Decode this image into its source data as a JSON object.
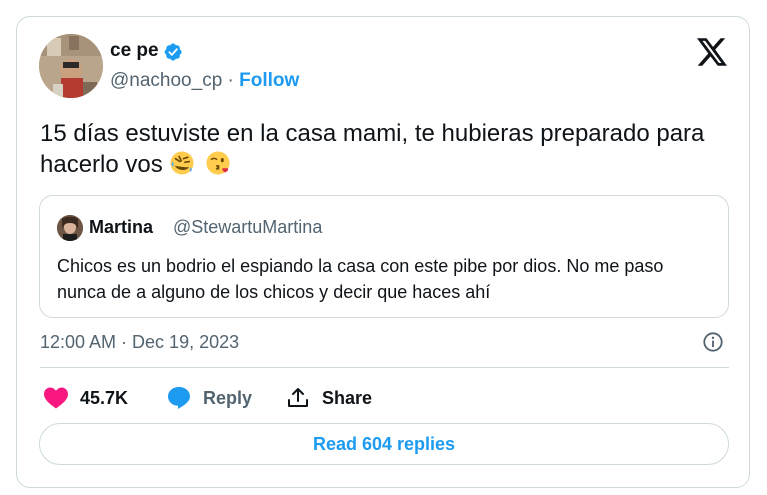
{
  "author": {
    "name": "ce pe",
    "handle": "@nachoo_cp",
    "separator": "·",
    "follow_label": "Follow"
  },
  "tweet": {
    "text": "15 días estuviste en la casa mami, te hubieras preparado para hacerlo vos",
    "emojis": [
      "rolling-on-floor-laughing-emoji",
      "face-blowing-kiss-emoji"
    ]
  },
  "quoted": {
    "name": "Martina",
    "handle": "@StewartuMartina",
    "text": "Chicos es un bodrio el espiando la casa con este pibe por dios. No me paso nunca de a alguno de los chicos y decir que haces ahí"
  },
  "meta": {
    "timestamp": "12:00 AM · Dec 19, 2023"
  },
  "actions": {
    "likes": "45.7K",
    "reply_label": "Reply",
    "share_label": "Share"
  },
  "read_replies_label": "Read 604 replies",
  "colors": {
    "accent": "#1d9bf0",
    "like": "#f91880",
    "muted": "#536471",
    "border": "#cfd9de"
  }
}
